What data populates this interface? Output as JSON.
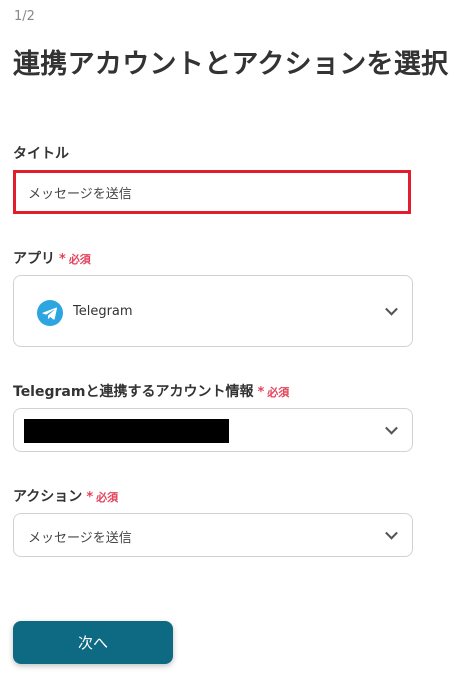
{
  "step_indicator": "1/2",
  "page_title": "連携アカウントとアクションを選択",
  "title_field": {
    "label": "タイトル",
    "value": "メッセージを送信"
  },
  "app_field": {
    "label": "アプリ",
    "required_mark": "必須",
    "selected_app": "Telegram",
    "icon": "telegram-icon"
  },
  "account_field": {
    "label": "Telegramと連携するアカウント情報",
    "required_mark": "必須"
  },
  "action_field": {
    "label": "アクション",
    "required_mark": "必須",
    "selected_value": "メッセージを送信"
  },
  "next_button": "次へ",
  "colors": {
    "accent": "#0d6a82",
    "required": "#e2445c",
    "highlight_border": "#e11d2e",
    "telegram": "#2ca5e0"
  }
}
